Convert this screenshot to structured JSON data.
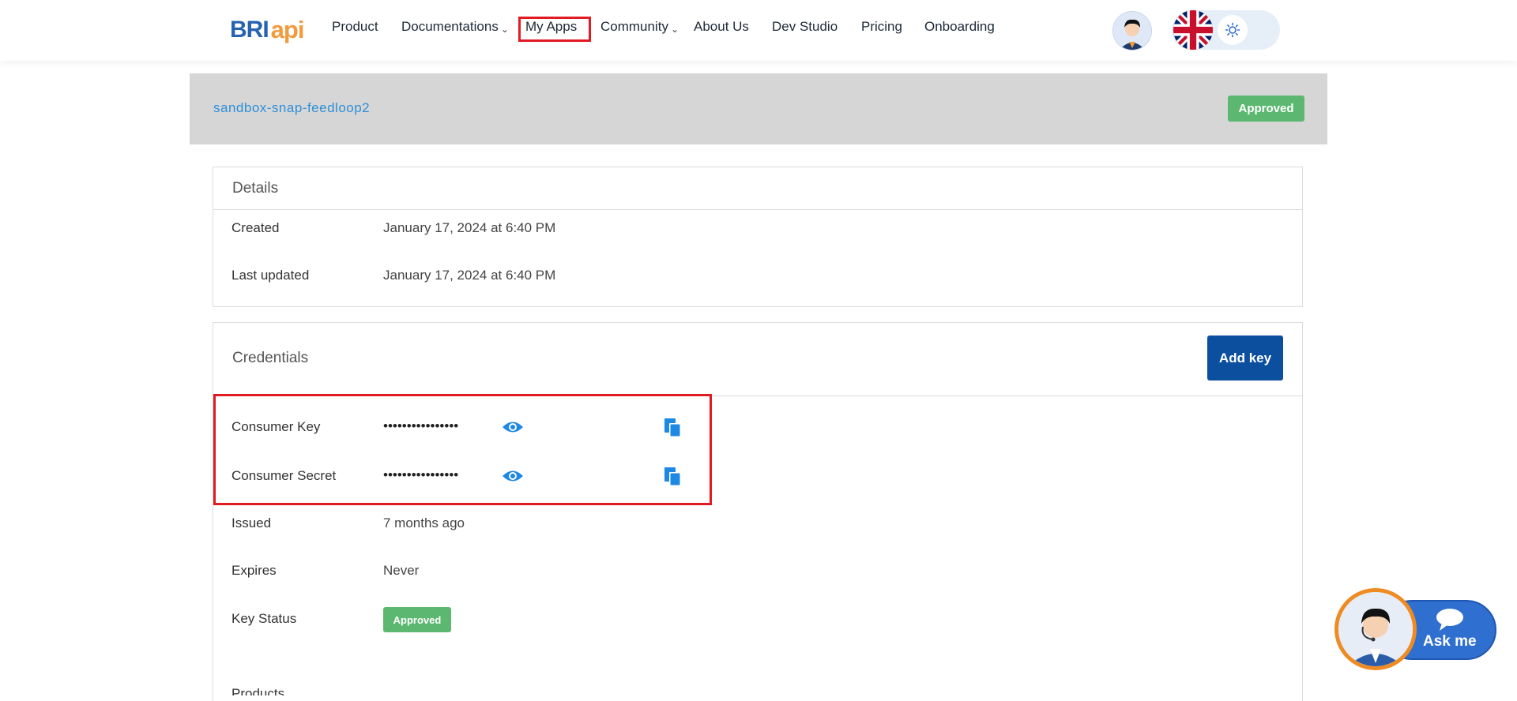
{
  "header": {
    "logo": {
      "bri": "BRI",
      "api": "api"
    },
    "nav": [
      {
        "label": "Product"
      },
      {
        "label": "Documentations",
        "has_dropdown": true
      },
      {
        "label": "My Apps",
        "highlighted": true
      },
      {
        "label": "Community",
        "has_dropdown": true
      },
      {
        "label": "About Us"
      },
      {
        "label": "Dev Studio"
      },
      {
        "label": "Pricing"
      },
      {
        "label": "Onboarding"
      }
    ],
    "avatar_icon": "user-avatar-icon",
    "language_flag_icon": "uk-flag-icon",
    "theme_toggle_icon": "sun-icon"
  },
  "app": {
    "name": "sandbox-snap-feedloop2",
    "status": "Approved"
  },
  "details": {
    "title": "Details",
    "rows": [
      {
        "label": "Created",
        "value": "January 17, 2024 at 6:40 PM"
      },
      {
        "label": "Last updated",
        "value": "January 17, 2024 at 6:40 PM"
      }
    ]
  },
  "credentials": {
    "title": "Credentials",
    "add_key_label": "Add key",
    "consumer_key": {
      "label": "Consumer Key",
      "masked": "••••••••••••••••"
    },
    "consumer_secret": {
      "label": "Consumer Secret",
      "masked": "••••••••••••••••"
    },
    "issued": {
      "label": "Issued",
      "value": "7 months ago"
    },
    "expires": {
      "label": "Expires",
      "value": "Never"
    },
    "key_status": {
      "label": "Key Status",
      "value": "Approved"
    },
    "partial_label": "Products"
  },
  "chat": {
    "label": "Ask me"
  },
  "colors": {
    "brand_blue": "#2763b1",
    "brand_orange": "#f29a3c",
    "primary_button": "#0b4f9e",
    "approved_green": "#5cb870",
    "link_blue": "#2f8fd8",
    "highlight_red": "#e21a22"
  }
}
